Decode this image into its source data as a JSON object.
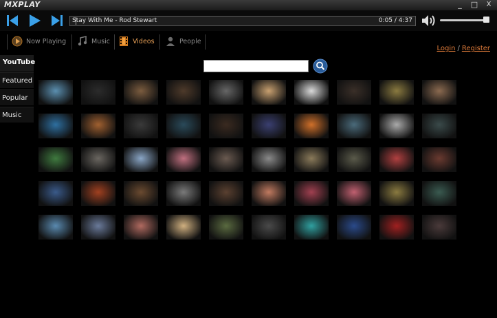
{
  "app": {
    "logo": "MXPLAY",
    "min_label": "_",
    "max_label": "□",
    "close_label": "X"
  },
  "player": {
    "track_title": "Stay With Me - Rod Stewart",
    "time": "0:05 / 4:37",
    "volume_percent": 95
  },
  "nav": {
    "tabs": [
      {
        "label": "Now Playing",
        "icon": "play-circle-icon"
      },
      {
        "label": "Music",
        "icon": "music-note-icon"
      },
      {
        "label": "Videos",
        "icon": "film-icon",
        "active": true
      },
      {
        "label": "People",
        "icon": "person-icon"
      }
    ],
    "login": "Login",
    "separator": "/",
    "register": "Register"
  },
  "sidebar": {
    "logo_text": "YouTube",
    "items": [
      {
        "label": "Featured"
      },
      {
        "label": "Popular"
      },
      {
        "label": "Music"
      }
    ]
  },
  "search": {
    "value": "",
    "placeholder": ""
  },
  "thumbnails": [
    [
      "#5b8fb0",
      "#2b2b2b",
      "#7b5c3f",
      "#4e3a2a",
      "#666",
      "#c8a070",
      "#d9d9d9",
      "#3a2f28",
      "#8a7a40",
      "#8b6a50"
    ],
    [
      "#2e6fa0",
      "#a06030",
      "#3a3a3a",
      "#2a4a5a",
      "#3a2a20",
      "#3a3f70",
      "#d0702a",
      "#4a6a7a",
      "#aaaaaa",
      "#3a4a4a"
    ],
    [
      "#3f7a3f",
      "#6a6660",
      "#8aa6c6",
      "#c07080",
      "#6a5a50",
      "#8a8a8a",
      "#8a7a5a",
      "#5a5a4a",
      "#b04040",
      "#6a3a30"
    ],
    [
      "#3a5a8a",
      "#a04020",
      "#6a4a30",
      "#7a7a7a",
      "#5a4030",
      "#c07a60",
      "#a04050",
      "#c06070",
      "#8a7a40",
      "#3a5a50"
    ],
    [
      "#5a8ab0",
      "#6a7a9a",
      "#b06a60",
      "#d0b080",
      "#5a6a40",
      "#4a4a4a",
      "#30a0a0",
      "#2a4a8a",
      "#a02020",
      "#4a3a3a"
    ]
  ]
}
